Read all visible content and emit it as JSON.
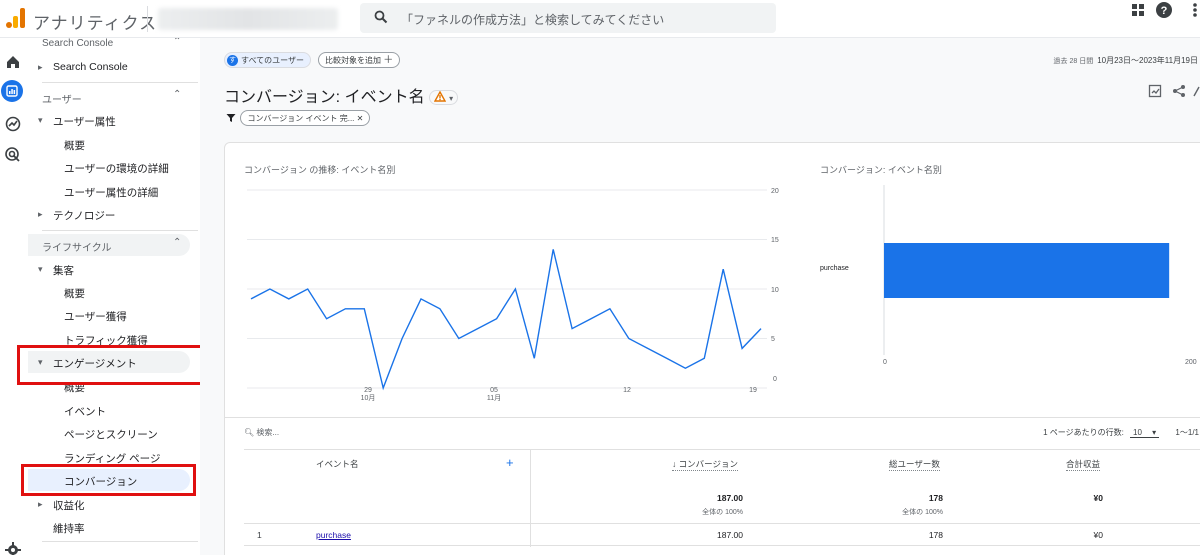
{
  "app": {
    "title": "アナリティクス",
    "search_placeholder": "「ファネルの作成方法」と検索してみてください"
  },
  "colors": {
    "accent": "#1a73e8",
    "logo_orange": "#f9ab00",
    "logo_dark": "#e37400",
    "highlight": "#e01010",
    "line": "#1a73e8",
    "bar": "#1a73e8"
  },
  "nav": {
    "search_console_section": "Search Console",
    "search_console_item": "Search Console",
    "user_section": "ユーザー",
    "user_attributes": "ユーザー属性",
    "ua_overview": "概要",
    "ua_env": "ユーザーの環境の詳細",
    "ua_attr": "ユーザー属性の詳細",
    "technology": "テクノロジー",
    "lifecycle": "ライフサイクル",
    "acquisition": "集客",
    "acq_overview": "概要",
    "user_acq": "ユーザー獲得",
    "traffic_acq": "トラフィック獲得",
    "engagement": "エンゲージメント",
    "eng_overview": "概要",
    "events": "イベント",
    "pages": "ページとスクリーン",
    "landing": "ランディング ページ",
    "conversions": "コンバージョン",
    "monetization": "収益化",
    "retention": "維持率"
  },
  "header": {
    "all_users_chip": "すべてのユーザー",
    "all_users_avatar": "す",
    "add_compare_chip": "比較対象を追加",
    "date_prefix": "過去 28 日間",
    "date_range": "10月23日～2023年11月19日",
    "page_title": "コンバージョン: イベント名",
    "filter_chip": "コンバージョン イベント 完..."
  },
  "line_chart": {
    "title": "コンバージョン の推移: イベント名別",
    "y_ticks": [
      "20",
      "15",
      "10",
      "5",
      "0"
    ],
    "x_ticks": [
      {
        "label": "29",
        "sub": "10月"
      },
      {
        "label": "05",
        "sub": "11月"
      },
      {
        "label": "12",
        "sub": ""
      },
      {
        "label": "19",
        "sub": ""
      }
    ]
  },
  "bar_chart": {
    "title": "コンバージョン: イベント名別",
    "category": "purchase",
    "x_ticks": [
      "0",
      "200"
    ]
  },
  "chart_data": [
    {
      "type": "line",
      "title": "コンバージョン の推移: イベント名別",
      "x": [
        "10/23",
        "10/24",
        "10/25",
        "10/26",
        "10/27",
        "10/28",
        "10/29",
        "10/30",
        "10/31",
        "11/01",
        "11/02",
        "11/03",
        "11/04",
        "11/05",
        "11/06",
        "11/07",
        "11/08",
        "11/09",
        "11/10",
        "11/11",
        "11/12",
        "11/13",
        "11/14",
        "11/15",
        "11/16",
        "11/17",
        "11/18",
        "11/19"
      ],
      "series": [
        {
          "name": "purchase",
          "values": [
            9,
            10,
            9,
            10,
            7,
            8,
            8,
            0,
            5,
            9,
            8,
            5,
            6,
            7,
            10,
            3,
            14,
            6,
            7,
            8,
            5,
            4,
            3,
            2,
            3,
            12,
            4,
            6
          ]
        }
      ],
      "ylim": [
        0,
        20
      ]
    },
    {
      "type": "bar",
      "title": "コンバージョン: イベント名別",
      "categories": [
        "purchase"
      ],
      "values": [
        187
      ],
      "xlim": [
        0,
        200
      ]
    }
  ],
  "table": {
    "search_placeholder": "検索...",
    "rows_per_page_label": "1 ページあたりの行数:",
    "rows_per_page": "10",
    "pagination": "1～1/1",
    "col_event": "イベント名",
    "col_conv": "↓ コンバージョン",
    "col_users": "総ユーザー数",
    "col_revenue": "合計収益",
    "total_conv": "187.00",
    "total_conv_sub": "全体の 100%",
    "total_users": "178",
    "total_users_sub": "全体の 100%",
    "total_revenue": "¥0",
    "rows": [
      {
        "index": "1",
        "event": "purchase",
        "conv": "187.00",
        "users": "178",
        "revenue": "¥0"
      }
    ]
  }
}
